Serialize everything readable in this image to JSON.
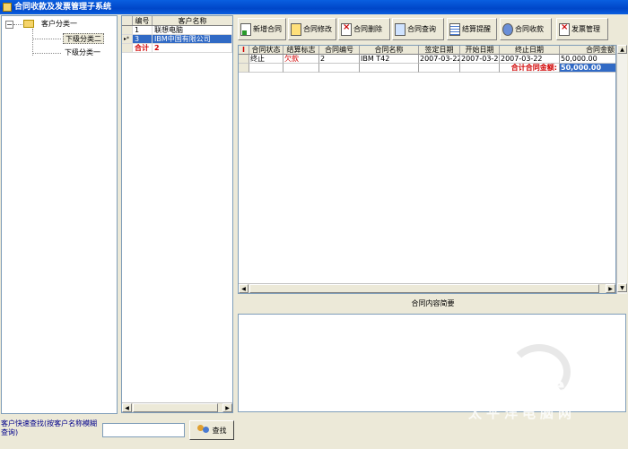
{
  "window": {
    "title": "合同收款及发票管理子系统"
  },
  "tree": {
    "root": "客户分类一",
    "children": [
      "下级分类二",
      "下级分类一"
    ]
  },
  "customers": {
    "headers": [
      "编号",
      "客户名称"
    ],
    "rows": [
      {
        "marker": "",
        "id": "1",
        "name": "联想电脑"
      },
      {
        "marker": "▸*",
        "id": "3",
        "name": "IBM中国有限公司"
      }
    ],
    "total_label": "合计",
    "total_value": "2"
  },
  "toolbar": {
    "buttons": [
      "新增合同",
      "合同修改",
      "合同删除",
      "合同查询",
      "结算提醒",
      "合同收款",
      "发票管理"
    ]
  },
  "contracts": {
    "headers": [
      "合同状态",
      "结算标志",
      "合同编号",
      "合同名称",
      "签定日期",
      "开始日期",
      "终止日期",
      "合同金额"
    ],
    "row_marker": "I",
    "rows": [
      {
        "status": "终止",
        "settle": "欠款",
        "no": "2",
        "name": "IBM T42",
        "sign": "2007-03-22",
        "start": "2007-03-22",
        "end": "2007-03-22",
        "amount": "50,000.00"
      }
    ],
    "total_label": "合计合同金额:",
    "total_value": "50,000.00"
  },
  "summary": {
    "label": "合同内容简要"
  },
  "search": {
    "label": "客户快速查找(按客户名称模糊查询)",
    "value": "",
    "button": "查找"
  },
  "watermark": {
    "brand": "PConline",
    "domain": ".com.cn",
    "cn": "太平洋电脑网"
  },
  "colors": {
    "titlebar": "#0a5fe0",
    "selection": "#316ac5",
    "accent_red": "#d00000"
  }
}
